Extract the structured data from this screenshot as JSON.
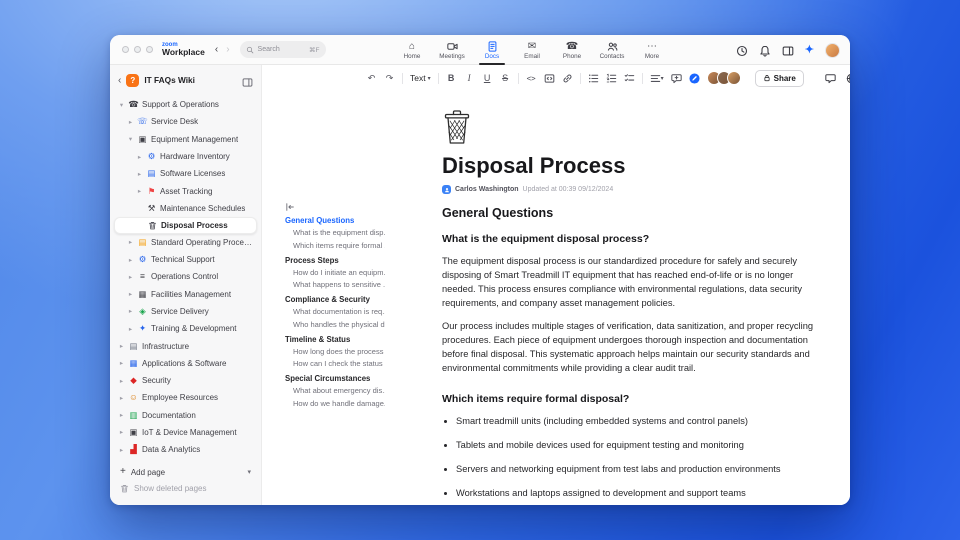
{
  "topbar": {
    "logo_top": "zoom",
    "logo_main": "Workplace",
    "search": {
      "placeholder": "Search",
      "shortcut": "⌘F"
    },
    "nav": [
      {
        "icon": "home-icon",
        "label": "Home"
      },
      {
        "icon": "meetings-icon",
        "label": "Meetings"
      },
      {
        "icon": "docs-icon",
        "label": "Docs",
        "active": true
      },
      {
        "icon": "email-icon",
        "label": "Email"
      },
      {
        "icon": "phone-icon",
        "label": "Phone"
      },
      {
        "icon": "contacts-icon",
        "label": "Contacts"
      },
      {
        "icon": "more-icon",
        "label": "More"
      }
    ],
    "right_icons": [
      {
        "name": "history-icon"
      },
      {
        "name": "bell-icon"
      },
      {
        "name": "layout-icon"
      },
      {
        "name": "ai-companion-icon"
      },
      {
        "name": "user-avatar"
      }
    ]
  },
  "icons": {
    "back-icon": "‹",
    "forward-icon": "›",
    "home-icon": "⌂",
    "email-icon": "✉",
    "phone-icon": "☎",
    "more-icon": "⋯",
    "undo-icon": "↶",
    "redo-icon": "↷",
    "caret-icon": "▾",
    "ai-companion-icon": "✦",
    "plus-icon": "+",
    "chevron-right": "▸",
    "chevron-down": "▾"
  },
  "sidebar": {
    "title": "IT FAQs Wiki",
    "badge": "?",
    "items": [
      {
        "label": "Support & Operations",
        "level": 1,
        "chevron": "down",
        "glyph": "☎",
        "color": "#3f3f46"
      },
      {
        "label": "Service Desk",
        "level": 2,
        "chevron": "right",
        "glyph": "☏",
        "color": "#2563eb"
      },
      {
        "label": "Equipment Management",
        "level": 2,
        "chevron": "down",
        "glyph": "▣",
        "color": "#3f3f46"
      },
      {
        "label": "Hardware Inventory",
        "level": 3,
        "chevron": "right",
        "glyph": "⚙",
        "color": "#2563eb"
      },
      {
        "label": "Software Licenses",
        "level": 3,
        "chevron": "right",
        "glyph": "▤",
        "color": "#2563eb"
      },
      {
        "label": "Asset Tracking",
        "level": 3,
        "chevron": "right",
        "glyph": "⚑",
        "color": "#ef4444"
      },
      {
        "label": "Maintenance Schedules",
        "level": 3,
        "chevron": "",
        "glyph": "⚒",
        "color": "#3f3f46"
      },
      {
        "label": "Disposal Process",
        "level": 3,
        "chevron": "",
        "svg": "trash-sm",
        "color": "#52525b",
        "selected": true
      },
      {
        "label": "Standard Operating Procedures",
        "level": 2,
        "chevron": "right",
        "glyph": "▤",
        "color": "#f59e0b"
      },
      {
        "label": "Technical Support",
        "level": 2,
        "chevron": "right",
        "glyph": "⚙",
        "color": "#2563eb"
      },
      {
        "label": "Operations Control",
        "level": 2,
        "chevron": "right",
        "glyph": "≡",
        "color": "#3f3f46"
      },
      {
        "label": "Facilities Management",
        "level": 2,
        "chevron": "right",
        "glyph": "▦",
        "color": "#3f3f46"
      },
      {
        "label": "Service Delivery",
        "level": 2,
        "chevron": "right",
        "glyph": "◈",
        "color": "#16a34a"
      },
      {
        "label": "Training & Development",
        "level": 2,
        "chevron": "right",
        "glyph": "✦",
        "color": "#2563eb"
      },
      {
        "label": "Infrastructure",
        "level": 1,
        "chevron": "right",
        "glyph": "▤",
        "color": "#6b7280"
      },
      {
        "label": "Applications & Software",
        "level": 1,
        "chevron": "right",
        "glyph": "▦",
        "color": "#2563eb"
      },
      {
        "label": "Security",
        "level": 1,
        "chevron": "right",
        "glyph": "◆",
        "color": "#dc2626"
      },
      {
        "label": "Employee Resources",
        "level": 1,
        "chevron": "right",
        "glyph": "☺",
        "color": "#d97706"
      },
      {
        "label": "Documentation",
        "level": 1,
        "chevron": "right",
        "glyph": "▥",
        "color": "#16a34a"
      },
      {
        "label": "IoT & Device Management",
        "level": 1,
        "chevron": "right",
        "glyph": "▣",
        "color": "#3f3f46"
      },
      {
        "label": "Data & Analytics",
        "level": 1,
        "chevron": "right",
        "glyph": "▟",
        "color": "#dc2626"
      }
    ],
    "add_page": "Add page",
    "show_deleted": "Show deleted pages"
  },
  "toolbar": {
    "text_style": "Text",
    "bold": "B",
    "italic": "I",
    "underline": "U",
    "strike": "S",
    "inline_code": "<>",
    "share": "Share",
    "collaborator_colors": [
      "#c98a5a",
      "#8a6a52",
      "#d9a066"
    ],
    "accent": "#1a66ff"
  },
  "outline": {
    "sections": [
      {
        "title": "General Questions",
        "active": true,
        "items": [
          "What is the equipment disp...",
          "Which items require formal ..."
        ]
      },
      {
        "title": "Process Steps",
        "items": [
          "How do I initiate an equipm...",
          "What happens to sensitive ..."
        ]
      },
      {
        "title": "Compliance & Security",
        "items": [
          "What documentation is req...",
          "Who handles the physical di..."
        ]
      },
      {
        "title": "Timeline & Status",
        "items": [
          "How long does the process ...",
          "How can I check the status ..."
        ]
      },
      {
        "title": "Special Circumstances",
        "items": [
          "What about emergency dis...",
          "How do we handle damage..."
        ]
      }
    ]
  },
  "document": {
    "title": "Disposal Process",
    "author": "Carlos Washington",
    "updated": "Updated at 00:39 09/12/2024",
    "section_heading": "General Questions",
    "questions": [
      {
        "heading": "What is the equipment disposal process?",
        "paragraphs": [
          "The equipment disposal process is our standardized procedure for safely and securely disposing of Smart Treadmill IT equipment that has reached end-of-life or is no longer needed. This process ensures compliance with environmental regulations, data security requirements, and company asset management policies.",
          "Our process includes multiple stages of verification, data sanitization, and proper recycling procedures. Each piece of equipment undergoes thorough inspection and documentation before final disposal. This systematic approach helps maintain our security standards and environmental commitments while providing a clear audit trail."
        ]
      },
      {
        "heading": "Which items require formal disposal?",
        "bullets": [
          "Smart treadmill units (including embedded systems and control panels)",
          "Tablets and mobile devices used for equipment testing and monitoring",
          "Servers and networking equipment from test labs and production environments",
          "Workstations and laptops assigned to development and support teams"
        ]
      }
    ]
  }
}
